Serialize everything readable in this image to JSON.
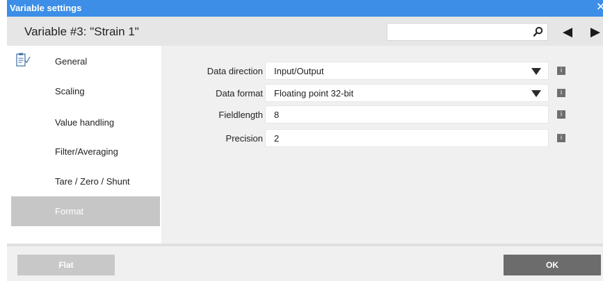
{
  "window": {
    "title": "Variable settings",
    "close_glyph": "✕"
  },
  "header": {
    "variable_title": "Variable #3: \"Strain 1\"",
    "search": {
      "value": "",
      "placeholder": ""
    }
  },
  "sidebar": {
    "icon": "document-edit-icon",
    "items": [
      {
        "label": "General",
        "active": false
      },
      {
        "label": "Scaling",
        "active": false
      },
      {
        "label": "Value handling",
        "active": false
      },
      {
        "label": "Filter/Averaging",
        "active": false
      },
      {
        "label": "Tare / Zero / Shunt",
        "active": false
      },
      {
        "label": "Format",
        "active": true
      }
    ]
  },
  "form": {
    "rows": [
      {
        "label": "Data direction",
        "value": "Input/Output",
        "type": "dropdown",
        "info": "i"
      },
      {
        "label": "Data format",
        "value": "Floating point 32-bit",
        "type": "dropdown",
        "info": "i"
      },
      {
        "label": "Fieldlength",
        "value": "8",
        "type": "text",
        "info": "i"
      },
      {
        "label": "Precision",
        "value": "2",
        "type": "text",
        "info": "i"
      }
    ]
  },
  "footer": {
    "flat_label": "Flat",
    "ok_label": "OK"
  },
  "colors": {
    "titlebar": "#3c8ee7",
    "active_nav": "#c6c6c6",
    "ok_button": "#6c6c6c",
    "flat_button": "#c8c8c8",
    "info_badge": "#6e6e6e"
  }
}
